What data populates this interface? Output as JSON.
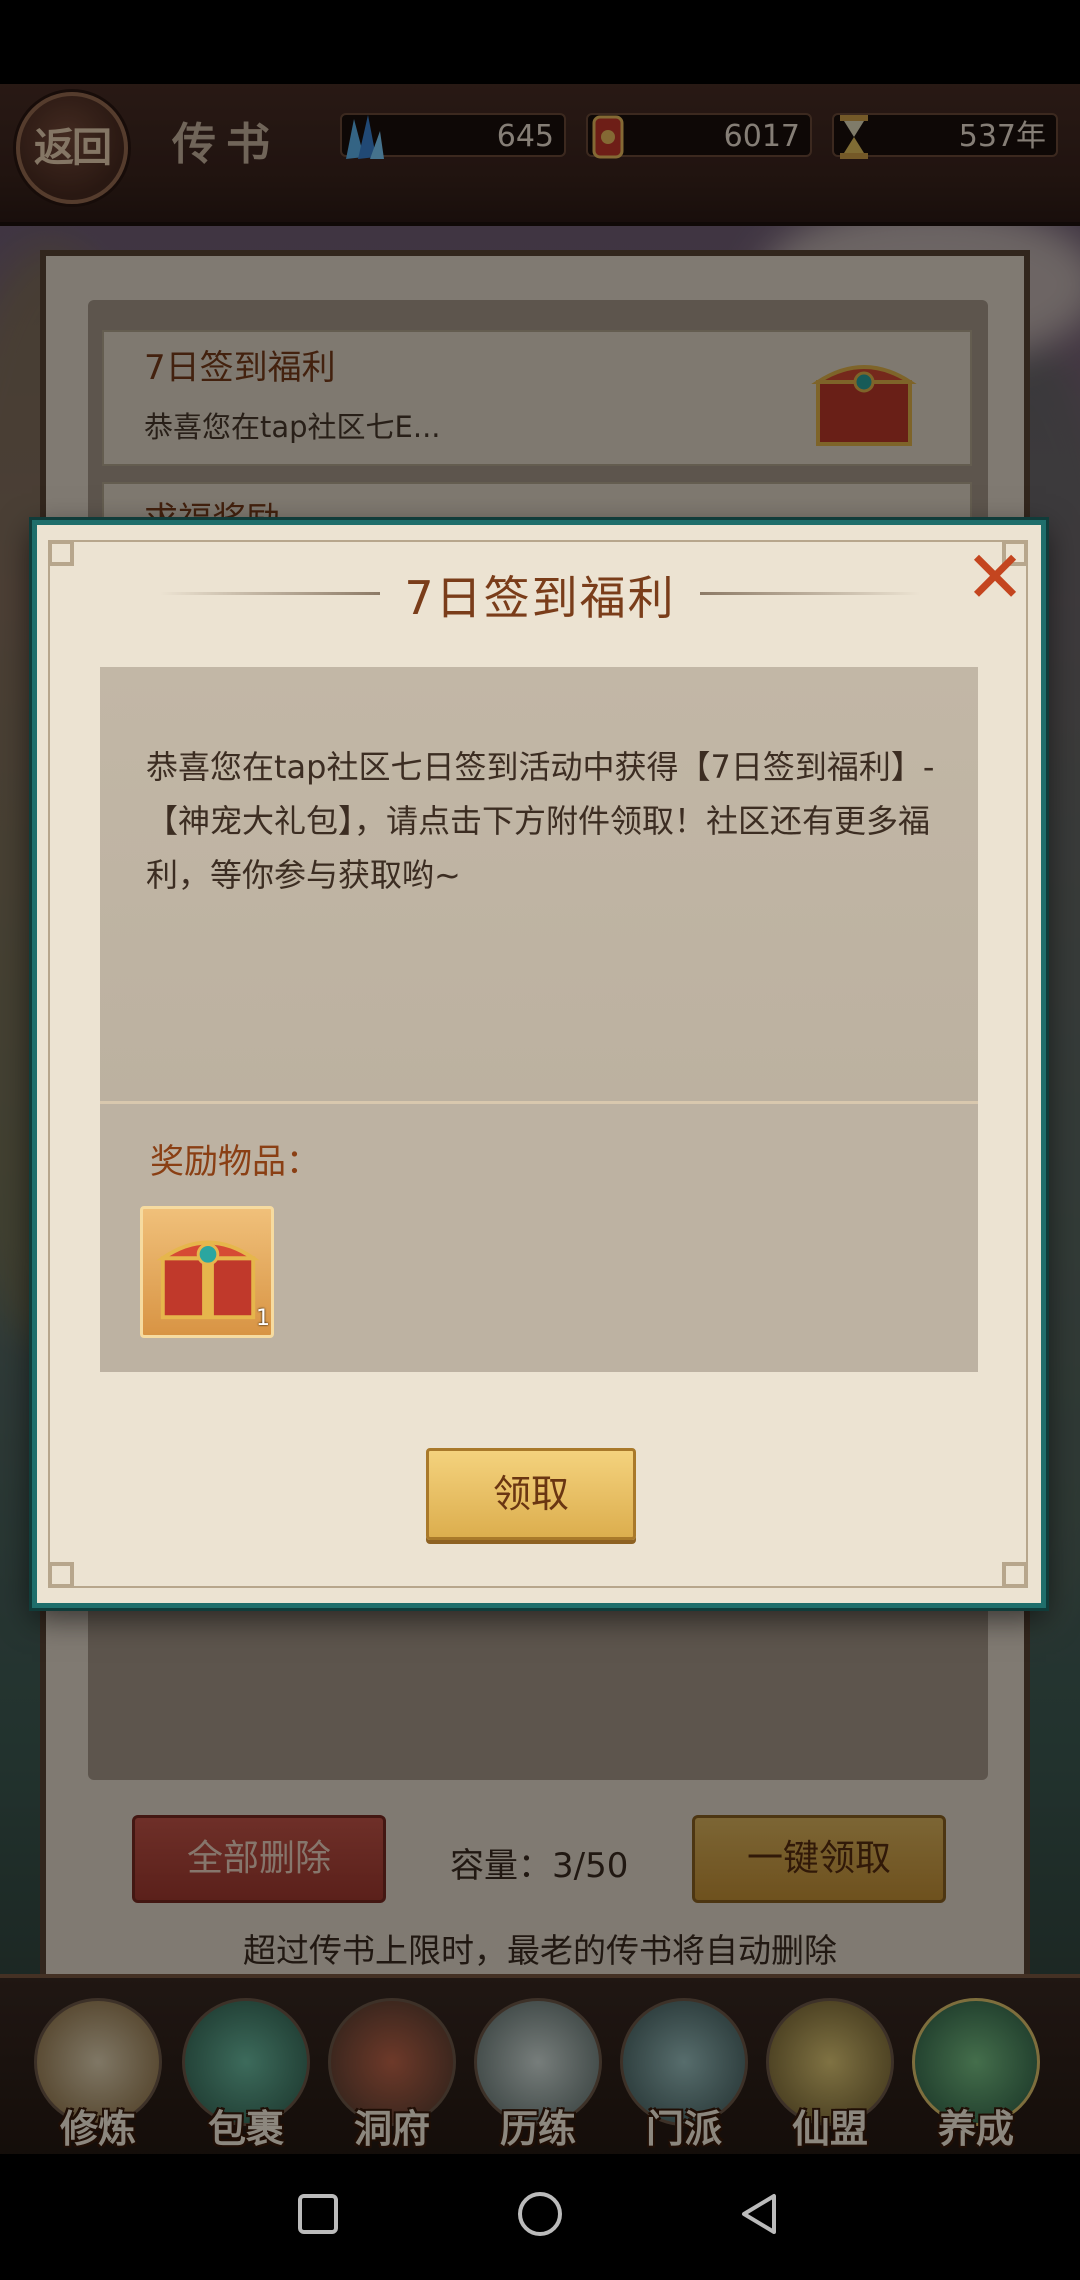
{
  "header": {
    "back_label": "返回",
    "title": "传书",
    "resources": [
      {
        "icon": "crystal-icon",
        "value": "645"
      },
      {
        "icon": "red-token-icon",
        "value": "6017"
      },
      {
        "icon": "hourglass-icon",
        "value": "537年"
      }
    ]
  },
  "mail_list": {
    "items": [
      {
        "title": "7日签到福利",
        "preview": "恭喜您在tap社区七E..."
      },
      {
        "title": "求福奖励",
        "preview": ""
      }
    ],
    "delete_all_label": "全部删除",
    "capacity": "容量：3/50",
    "collect_all_label": "一键领取",
    "hint": "超过传书上限时，最老的传书将自动删除"
  },
  "modal": {
    "title": "7日签到福利",
    "message": "恭喜您在tap社区七日签到活动中获得【7日签到福利】-【神宠大礼包】，请点击下方附件领取！社区还有更多福利，等你参与获取哟~",
    "reward_label": "奖励物品：",
    "reward_item": {
      "icon": "treasure-chest-icon",
      "count": "1"
    },
    "claim_label": "领取"
  },
  "bottom_nav": [
    {
      "label": "修炼",
      "icon": "cultivator-icon"
    },
    {
      "label": "包裹",
      "icon": "bag-icon"
    },
    {
      "label": "洞府",
      "icon": "cave-mansion-icon"
    },
    {
      "label": "历练",
      "icon": "scroll-icon"
    },
    {
      "label": "门派",
      "icon": "sect-gate-icon"
    },
    {
      "label": "仙盟",
      "icon": "alliance-icon"
    },
    {
      "label": "养成",
      "icon": "pentagram-icon"
    }
  ],
  "colors": {
    "accent_teal": "#1f6e6b",
    "title_brown": "#7a3d1a",
    "claim_gold": "#dcae4e",
    "delete_red": "#a63b31"
  }
}
